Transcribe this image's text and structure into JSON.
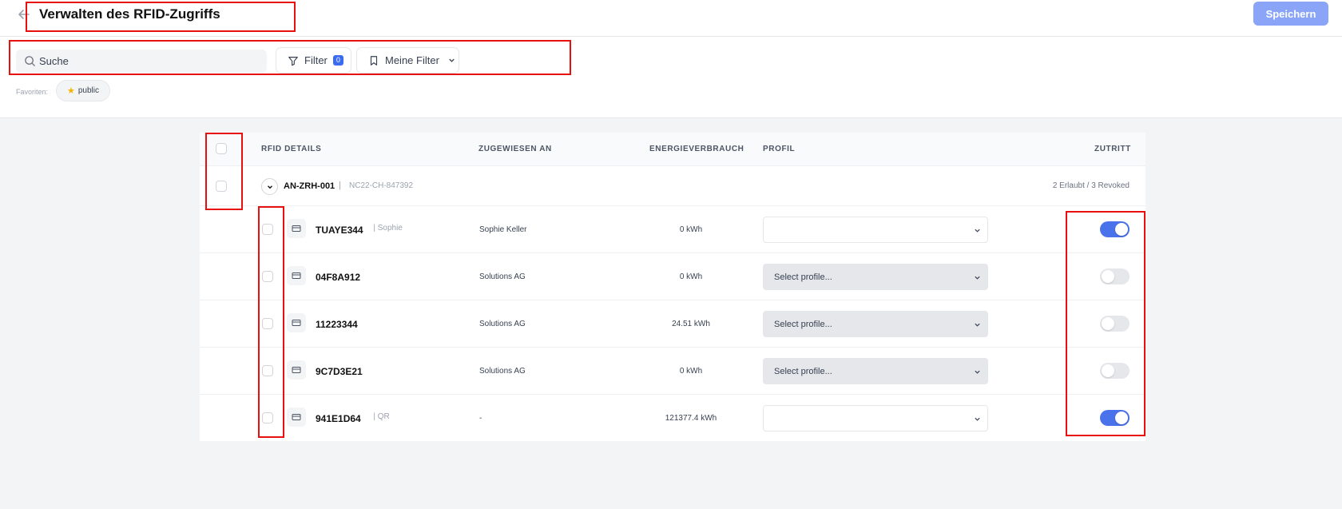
{
  "header": {
    "title": "Verwalten des RFID-Zugriffs",
    "save_label": "Speichern"
  },
  "toolbar": {
    "search_placeholder": "Suche",
    "filter_label": "Filter",
    "filter_count": "0",
    "my_filters_label": "Meine Filter",
    "favorites_label": "Favoriten:",
    "favorite_chip": "public"
  },
  "table": {
    "columns": {
      "details": "RFID DETAILS",
      "assigned": "ZUGEWIESEN AN",
      "energy": "ENERGIEVERBRAUCH",
      "profile": "PROFIL",
      "access": "ZUTRITT"
    },
    "group": {
      "name": "AN-ZRH-001",
      "separator": "|",
      "code": "NC22-CH-847392",
      "summary": "2 Erlaubt / 3 Revoked"
    },
    "rows": [
      {
        "id": "TUAYE344",
        "sub": "| Sophie",
        "assigned": "Sophie Keller",
        "energy": "0 kWh",
        "profile": "",
        "access": true
      },
      {
        "id": "04F8A912",
        "sub": "",
        "assigned": "Solutions AG",
        "energy": "0 kWh",
        "profile": "Select profile...",
        "access": false
      },
      {
        "id": "11223344",
        "sub": "",
        "assigned": "Solutions AG",
        "energy": "24.51 kWh",
        "profile": "Select profile...",
        "access": false
      },
      {
        "id": "9C7D3E21",
        "sub": "",
        "assigned": "Solutions AG",
        "energy": "0 kWh",
        "profile": "Select profile...",
        "access": false
      },
      {
        "id": "941E1D64",
        "sub": "| QR",
        "assigned": "-",
        "energy": "121377.4 kWh",
        "profile": "",
        "access": true
      }
    ]
  },
  "colors": {
    "accent": "#4a72eb",
    "save_button": "#8aa5f7",
    "highlight": "#e8100f"
  }
}
